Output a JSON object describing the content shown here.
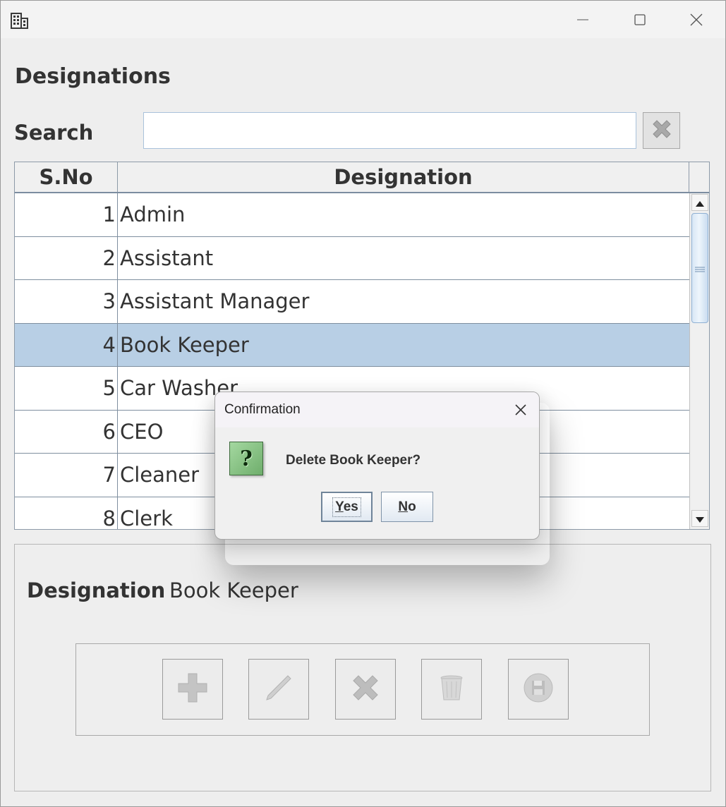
{
  "window": {
    "title": "",
    "icon": "building-icon",
    "controls": [
      "minimize-icon",
      "maximize-icon",
      "close-icon"
    ]
  },
  "page": {
    "title": "Designations"
  },
  "search": {
    "label": "Search",
    "value": "",
    "placeholder": "",
    "clear_icon": "clear-x-icon"
  },
  "table": {
    "headers": {
      "sno": "S.No",
      "designation": "Designation"
    },
    "selected_index": 3,
    "rows": [
      {
        "sno": "1",
        "designation": "Admin"
      },
      {
        "sno": "2",
        "designation": "Assistant"
      },
      {
        "sno": "3",
        "designation": "Assistant Manager"
      },
      {
        "sno": "4",
        "designation": "Book Keeper"
      },
      {
        "sno": "5",
        "designation": "Car Washer"
      },
      {
        "sno": "6",
        "designation": "CEO"
      },
      {
        "sno": "7",
        "designation": "Cleaner"
      },
      {
        "sno": "8",
        "designation": "Clerk"
      }
    ]
  },
  "detail": {
    "label": "Designation",
    "value": "Book Keeper"
  },
  "toolbar": {
    "buttons": [
      "add-icon",
      "edit-pencil-icon",
      "cancel-x-icon",
      "delete-trash-icon",
      "save-disk-icon"
    ]
  },
  "dialog": {
    "title": "Confirmation",
    "message": "Delete Book Keeper?",
    "icon": "question-icon",
    "icon_glyph": "?",
    "yes_mnemonic": "Y",
    "yes_rest": "es",
    "no_mnemonic": "N",
    "no_rest": "o"
  },
  "colors": {
    "selection": "#b8cfe5",
    "window_bg": "#eeeeee",
    "question_icon": "#8ccb88"
  }
}
